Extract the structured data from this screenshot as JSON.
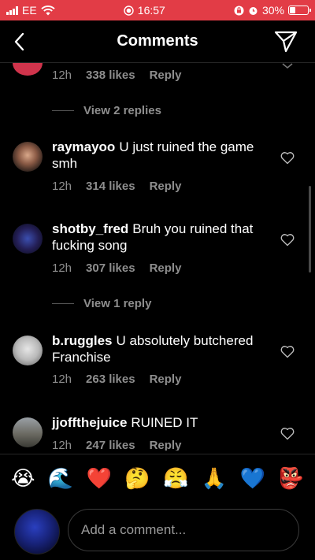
{
  "status_bar": {
    "carrier": "EE",
    "time": "16:57",
    "battery": "30%",
    "battery_level": 0.3,
    "background": "#e23c46"
  },
  "header": {
    "title": "Comments",
    "back_icon": "chevron-left-icon",
    "send_icon": "paper-plane-icon"
  },
  "top_comment": {
    "time": "12h",
    "likes": "338 likes",
    "reply": "Reply"
  },
  "view_replies_1": "View 2 replies",
  "comments": [
    {
      "username": "raymayoo",
      "text": "U just ruined the game smh",
      "time": "12h",
      "likes": "314 likes",
      "reply": "Reply",
      "avatar_color": "#3a2a24"
    },
    {
      "username": "shotby_fred",
      "text": "Bruh you ruined that fucking song",
      "time": "12h",
      "likes": "307 likes",
      "reply": "Reply",
      "avatar_color": "#2a2f6a"
    },
    {
      "username": "b.ruggles",
      "text": "U absolutely butchered Franchise",
      "time": "12h",
      "likes": "263 likes",
      "reply": "Reply",
      "avatar_color": "#cfcfcf"
    },
    {
      "username": "jjoffthejuice",
      "text": "RUINED IT",
      "time": "12h",
      "likes": "247 likes",
      "reply": "Reply",
      "avatar_color": "#7a7c78"
    }
  ],
  "view_replies_2": "View 1 reply",
  "emoji_bar": [
    "😭",
    "🌊",
    "❤️",
    "🤔",
    "😤",
    "🙏",
    "💙",
    "👺"
  ],
  "composer": {
    "placeholder": "Add a comment..."
  }
}
